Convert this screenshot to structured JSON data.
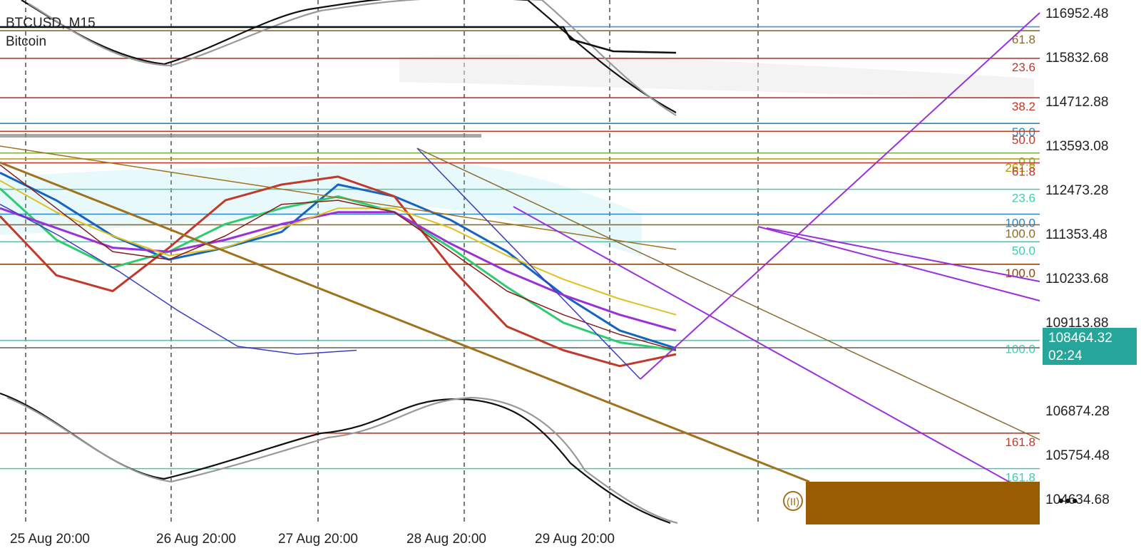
{
  "header": {
    "symbol": "BTCUSD, M15",
    "description": "Bitcoin"
  },
  "current_price": {
    "value": "108464.32",
    "timer": "02:24",
    "color": "#26a69a"
  },
  "chart_data": {
    "type": "line",
    "title": "BTCUSD, M15",
    "xlabel": "",
    "ylabel": "",
    "ylim": [
      103700,
      117500
    ],
    "y_ticks": [
      116952.48,
      115832.68,
      114712.88,
      113593.08,
      112473.28,
      111353.48,
      110233.68,
      109113.88,
      106874.28,
      105754.48,
      104634.68
    ],
    "y_tick_labels": [
      "116952.48",
      "115832.68",
      "114712.88",
      "113593.08",
      "112473.28",
      "111353.48",
      "110233.68",
      "109113.88",
      "106874.28",
      "105754.48",
      "104634.68"
    ],
    "x_tick_labels": [
      "25 Aug 20:00",
      "26 Aug 20:00",
      "27 Aug 20:00",
      "28 Aug 20:00",
      "29 Aug 20:00"
    ],
    "grid": true,
    "horizontal_levels": [
      {
        "price": 116500,
        "color": "#8b6a2e",
        "label": "61.8"
      },
      {
        "price": 116600,
        "color": "#3a9ad9",
        "label": ""
      },
      {
        "price": 115800,
        "color": "#c0392b",
        "label": "23.6"
      },
      {
        "price": 114800,
        "color": "#c0392b",
        "label": "38.2"
      },
      {
        "price": 114150,
        "color": "#2e86c1",
        "label": "50.0"
      },
      {
        "price": 113950,
        "color": "#c0392b",
        "label": "50.0"
      },
      {
        "price": 113400,
        "color": "#7cb342",
        "label": "0.0"
      },
      {
        "price": 113250,
        "color": "#b7950b",
        "label": "261.8"
      },
      {
        "price": 113150,
        "color": "#c0392b",
        "label": "61.8"
      },
      {
        "price": 112480,
        "color": "#48c9b0",
        "label": "23.6"
      },
      {
        "price": 111850,
        "color": "#2e86c1",
        "label": "100.0"
      },
      {
        "price": 111580,
        "color": "#8b6a2e",
        "label": "100.0"
      },
      {
        "price": 111150,
        "color": "#48c9b0",
        "label": "50.0"
      },
      {
        "price": 110580,
        "color": "#8b4513",
        "label": "100.0"
      },
      {
        "price": 108650,
        "color": "#48c9b0",
        "label": "100.0"
      },
      {
        "price": 106300,
        "color": "#c0392b",
        "label": "161.8"
      },
      {
        "price": 105400,
        "color": "#48c9b0",
        "label": "161.8"
      },
      {
        "price": 103950,
        "color": "#2e86c1",
        "label": ""
      },
      {
        "price": 103800,
        "color": "#b7950b",
        "label": "161.8"
      }
    ],
    "series": [
      {
        "values": [
          112900,
          112200,
          111300,
          110700,
          111000,
          111400,
          112600,
          112300,
          111700,
          110900,
          109800,
          108900,
          108450
        ]
      },
      {
        "values": [
          112500,
          111200,
          110500,
          110900,
          111600,
          112000,
          112300,
          111900,
          111000,
          110000,
          109100,
          108600,
          108400
        ]
      },
      {
        "values": [
          111800,
          110300,
          109900,
          111000,
          112200,
          112600,
          112800,
          112300,
          110500,
          109000,
          108400,
          108000,
          108300
        ]
      },
      {
        "values": [
          112000,
          111500,
          111000,
          110900,
          111200,
          111600,
          111900,
          111900,
          111100,
          110400,
          109800,
          109300,
          108900
        ]
      },
      {
        "values": [
          112700,
          111900,
          111300,
          110800,
          111000,
          111500,
          112000,
          112000,
          111500,
          110800,
          110200,
          109700,
          109300
        ]
      },
      {
        "values": [
          112100,
          111300,
          110400,
          109400,
          108500,
          108300,
          108400
        ]
      },
      {
        "values": [
          113100,
          112000,
          110900,
          110700,
          111300,
          112100,
          112200,
          111900,
          110900,
          109900,
          109300,
          108800,
          108400
        ]
      }
    ],
    "ichimoku_hint": "cloud",
    "box_label": "(II)"
  },
  "ui": {
    "menu": "•••"
  }
}
